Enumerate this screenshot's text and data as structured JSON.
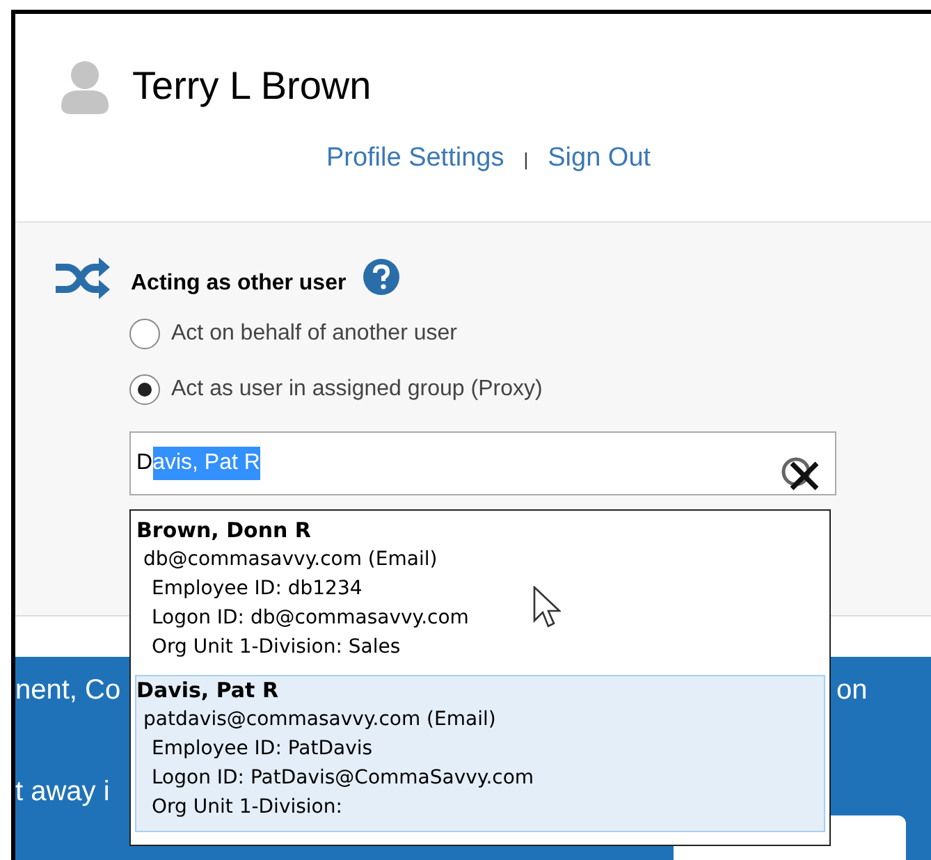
{
  "profile": {
    "name": "Terry L Brown",
    "links": [
      "Profile Settings",
      "Sign Out"
    ],
    "separator": "|"
  },
  "acting": {
    "title": "Acting as other user",
    "options": [
      {
        "label": "Act on behalf of another user",
        "selected": false
      },
      {
        "label": "Act as user in assigned group (Proxy)",
        "selected": true
      }
    ],
    "search": {
      "typed": "D",
      "autocomplete": "avis, Pat R"
    },
    "suggestions": [
      {
        "name": "Brown, Donn R",
        "email": "db@commasavvy.com (Email)",
        "details": [
          "Employee ID: db1234",
          "Logon ID: db@commasavvy.com",
          "Org Unit 1-Division: Sales"
        ],
        "selected": false
      },
      {
        "name": "Davis, Pat R",
        "email": "patdavis@commasavvy.com (Email)",
        "details": [
          "Employee ID: PatDavis",
          "Logon ID: PatDavis@CommaSavvy.com",
          "Org Unit 1-Division:"
        ],
        "selected": true
      }
    ]
  },
  "banner": {
    "texts": [
      "nent, Co",
      "on",
      "t away i"
    ]
  }
}
